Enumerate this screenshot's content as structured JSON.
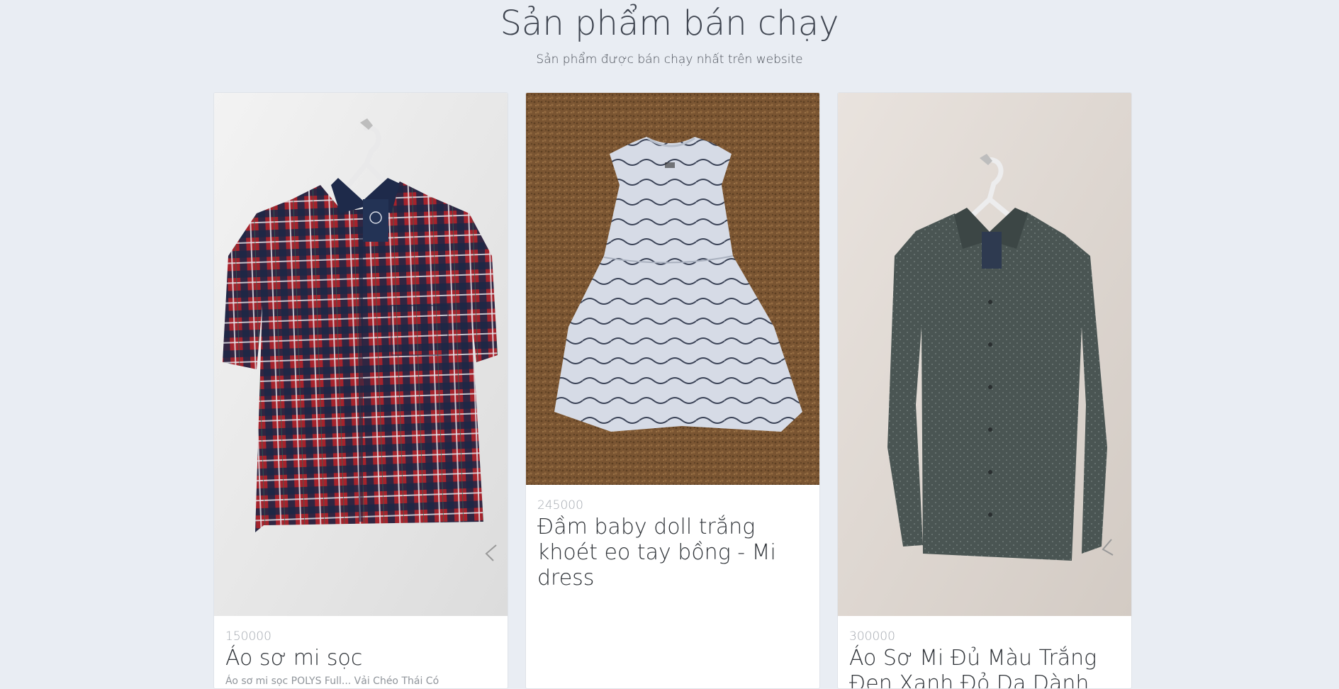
{
  "section": {
    "title": "Sản phẩm bán chạy",
    "subtitle": "Sản phẩm được bán chạy nhất trên website"
  },
  "products": [
    {
      "price": "150000",
      "name": "Áo sơ mi sọc",
      "description": "Áo sơ mi sọc POLYS Full... Vải Chéo Thái Có"
    },
    {
      "price": "245000",
      "name": "Đầm baby doll trắng khoét eo tay bồng - Mi dress",
      "description": ""
    },
    {
      "price": "300000",
      "name": "Áo Sơ Mi Đủ Màu Trắng Đen Xanh Đỏ Dạ Dành Cho N",
      "description": ""
    }
  ],
  "colors": {
    "page_background": "#e9edf3",
    "card_background": "#ffffff",
    "price_text": "#a4a9b0",
    "title_text": "#2f3338",
    "shirt_plaid_red": "#a5232c",
    "shirt_plaid_navy": "#1c2745",
    "dress_background": "#7a5532",
    "dress_fabric": "#d6dbe6",
    "shirt_grey": "#4a5553"
  },
  "icons": [
    "hanger-icon"
  ]
}
